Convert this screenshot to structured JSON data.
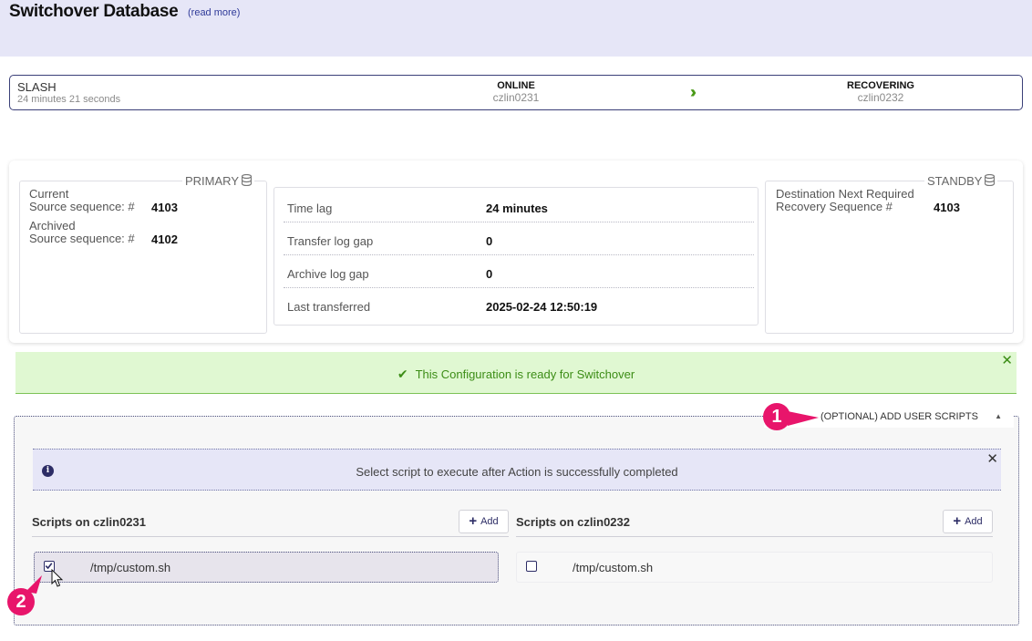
{
  "header": {
    "title": "Switchover Database",
    "read_more": "(read more)"
  },
  "status": {
    "name": "SLASH",
    "duration": "24 minutes 21 seconds",
    "source_state": "ONLINE",
    "source_host": "czlin0231",
    "target_state": "RECOVERING",
    "target_host": "czlin0232",
    "arrow_icon": "double-chevron-right-icon"
  },
  "primary": {
    "legend": "PRIMARY",
    "current_label_1": "Current",
    "current_label_2": "Source sequence: #",
    "current_value": "4103",
    "archived_label_1": "Archived",
    "archived_label_2": "Source sequence: #",
    "archived_value": "4102"
  },
  "lag": [
    {
      "label": "Time lag",
      "value": "24 minutes"
    },
    {
      "label": "Transfer log gap",
      "value": "0"
    },
    {
      "label": "Archive log gap",
      "value": "0"
    },
    {
      "label": "Last transferred",
      "value": "2025-02-24 12:50:19"
    }
  ],
  "standby": {
    "legend": "STANDBY",
    "label_1": "Destination Next Required",
    "label_2": "Recovery Sequence #",
    "value": "4103"
  },
  "success_message": "This Configuration is ready for Switchover",
  "scripts": {
    "toggle_label": "(OPTIONAL) ADD USER SCRIPTS",
    "info": "Select script to execute after Action is successfully completed",
    "add_label": "Add",
    "columns": [
      {
        "title": "Scripts on czlin0231",
        "script": "/tmp/custom.sh",
        "checked": true
      },
      {
        "title": "Scripts on czlin0232",
        "script": "/tmp/custom.sh",
        "checked": false
      }
    ]
  },
  "markers": [
    "1",
    "2"
  ],
  "colors": {
    "accent": "#2d2d66",
    "success": "#3c8d16",
    "marker": "#e8156b",
    "header_bg": "#e6e6f7"
  }
}
